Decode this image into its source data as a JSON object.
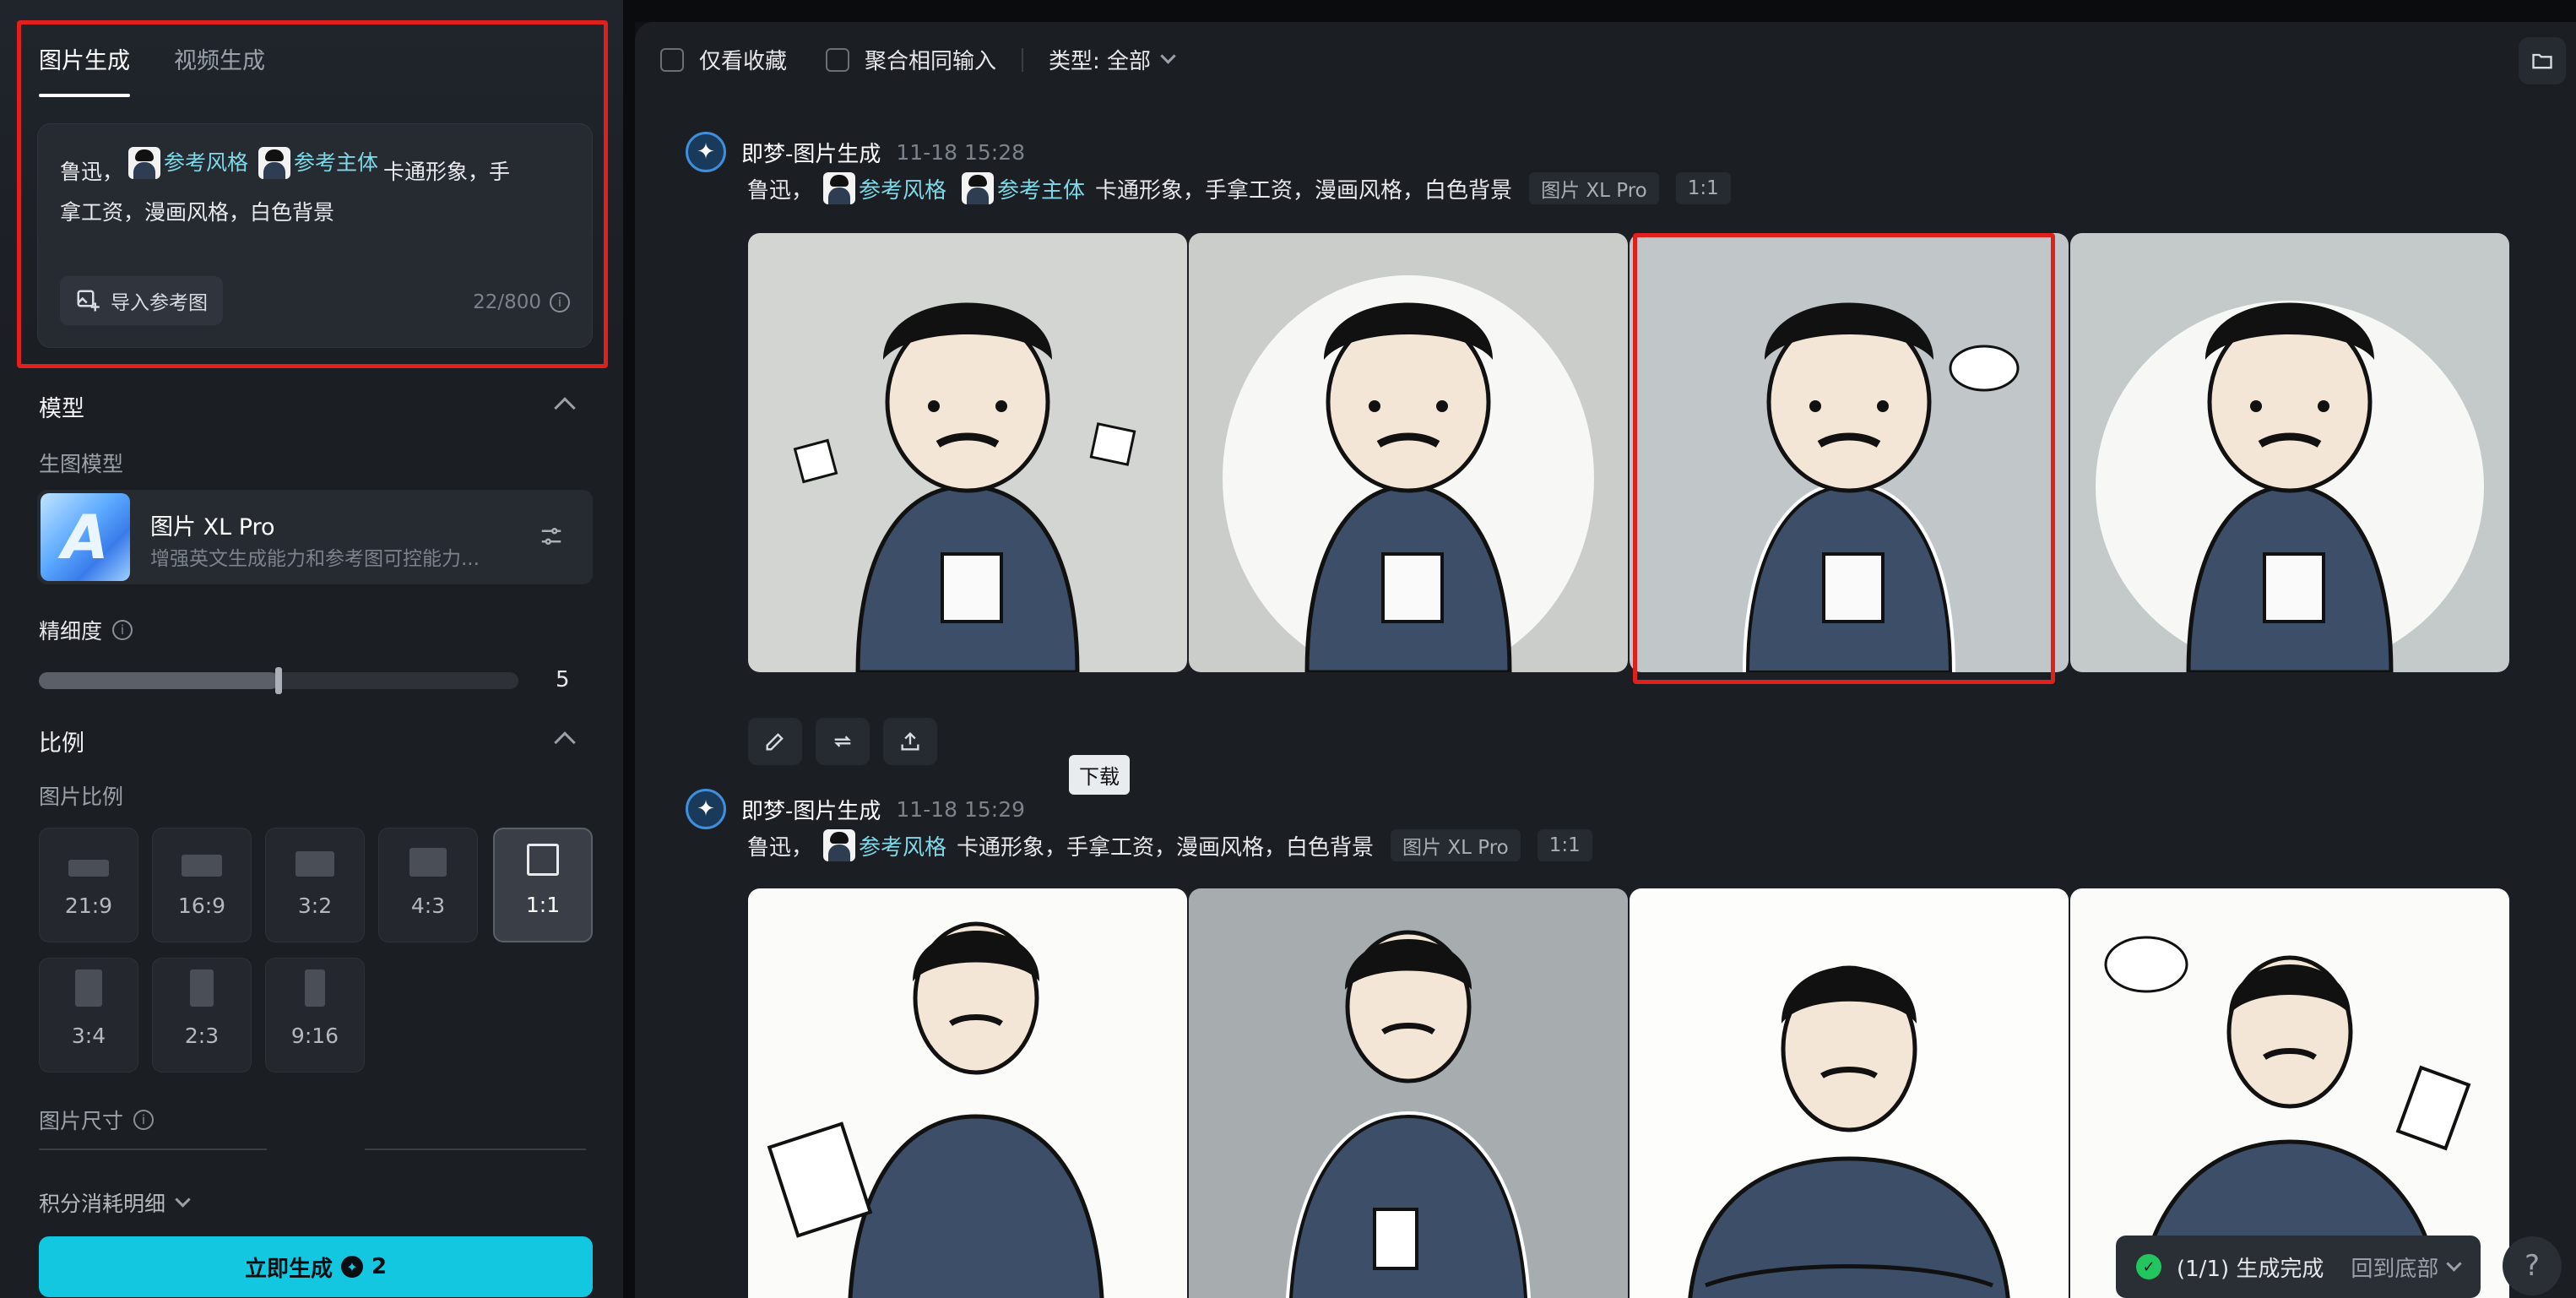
{
  "sidebar": {
    "tabs": [
      {
        "label": "图片生成",
        "active": true
      },
      {
        "label": "视频生成",
        "active": false
      }
    ],
    "prompt": {
      "prefix": "鲁迅，",
      "chip_style": "参考风格",
      "chip_subject": "参考主体",
      "suffix_line1": "卡通形象，手",
      "line2": "拿工资，漫画风格，白色背景",
      "import_label": "导入参考图",
      "counter": "22/800"
    },
    "model_section": {
      "title": "模型",
      "sub_label": "生图模型",
      "model_name": "图片 XL Pro",
      "model_desc": "增强英文生成能力和参考图可控能力...",
      "thumb_letter": "A"
    },
    "detail": {
      "label": "精细度",
      "value": "5",
      "level_fraction": 0.5
    },
    "ratio_section": {
      "title": "比例",
      "sub_label": "图片比例",
      "options": [
        "21:9",
        "16:9",
        "3:2",
        "4:3",
        "1:1",
        "3:4",
        "2:3",
        "9:16"
      ],
      "selected": "1:1"
    },
    "size_label": "图片尺寸",
    "credits_label": "积分消耗明细",
    "generate_label": "立即生成",
    "generate_cost": "2"
  },
  "main": {
    "filters": {
      "favorites": "仅看收藏",
      "merge": "聚合相同输入",
      "type": "类型: 全部"
    },
    "records": [
      {
        "title": "即梦-图片生成",
        "time": "11-18  15:28",
        "prompt_prefix": "鲁迅，",
        "chip_style": "参考风格",
        "chip_subject": "参考主体",
        "prompt_suffix": "卡通形象，手拿工资，漫画风格，白色背景",
        "model_tag": "图片 XL Pro",
        "ratio_tag": "1:1"
      },
      {
        "title": "即梦-图片生成",
        "time": "11-18  15:29",
        "prompt_prefix": "鲁迅，",
        "chip_style": "参考风格",
        "prompt_suffix": "卡通形象，手拿工资，漫画风格，白色背景",
        "model_tag": "图片 XL Pro",
        "ratio_tag": "1:1"
      }
    ],
    "tooltip": "下载",
    "toast": {
      "status": "(1/1) 生成完成",
      "back": "回到底部"
    },
    "help": "?"
  }
}
